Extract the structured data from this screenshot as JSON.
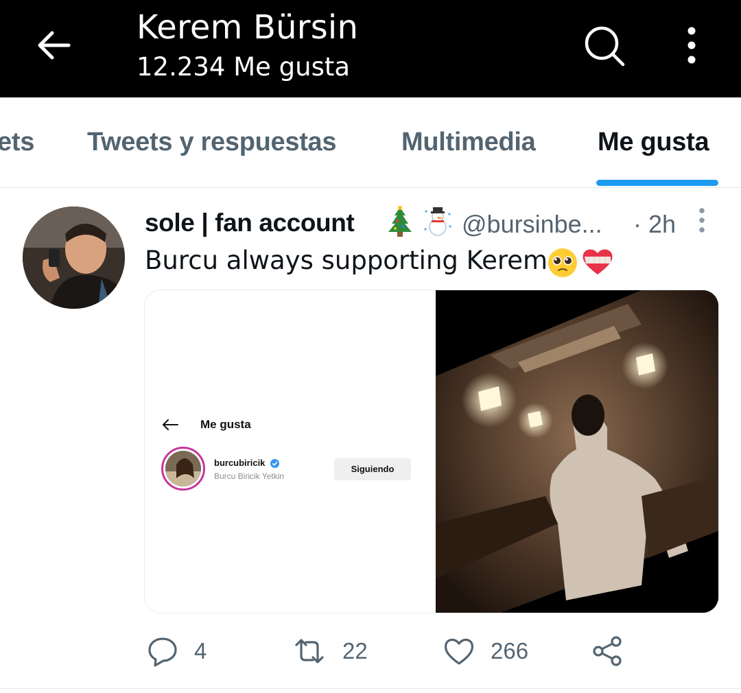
{
  "header": {
    "title": "Kerem Bürsin",
    "subtitle": "12.234 Me gusta",
    "back_icon": "arrow-left-icon",
    "search_icon": "search-icon",
    "more_icon": "more-vertical-icon"
  },
  "tabs": [
    {
      "label": "ets",
      "active": false
    },
    {
      "label": "Tweets y respuestas",
      "active": false
    },
    {
      "label": "Multimedia",
      "active": false
    },
    {
      "label": "Me gusta",
      "active": true
    }
  ],
  "tweet": {
    "display_name": "sole | fan account",
    "name_emojis": [
      "christmas-tree",
      "snowman"
    ],
    "handle": "@bursinbe...",
    "time": "· 2h",
    "text": "Burcu always supporting Kerem",
    "text_emojis": [
      "pleading-face",
      "mending-heart"
    ],
    "media": {
      "left": {
        "title": "Me gusta",
        "username": "burcubiricik",
        "full_name": "Burcu Biricik Yetkin",
        "follow_button": "Siguiendo"
      },
      "right": {
        "description": "photo"
      }
    },
    "actions": {
      "replies": "4",
      "retweets": "22",
      "likes": "266"
    }
  },
  "colors": {
    "accent": "#1d9bf0",
    "header_bg": "#000000",
    "muted_text": "#536471"
  }
}
